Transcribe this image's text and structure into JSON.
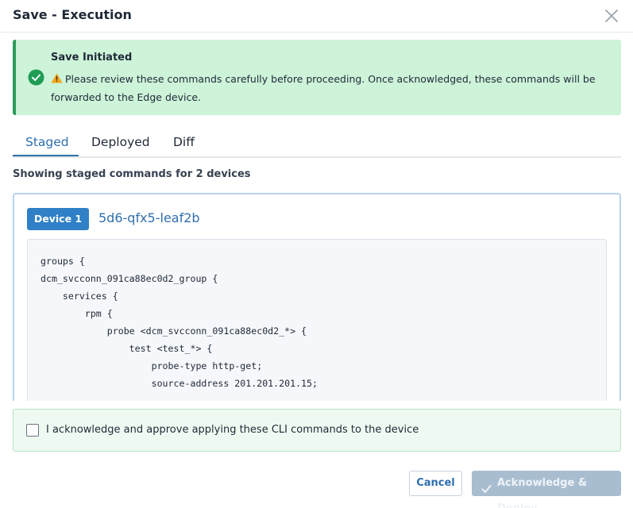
{
  "modal": {
    "title": "Save - Execution",
    "close_icon": "close-icon"
  },
  "alert": {
    "icon": "check-circle-icon",
    "title": "Save Initiated",
    "warning_icon": "warning-triangle-icon",
    "message": "Please review these commands carefully before proceeding. Once acknowledged, these commands will be forwarded to the Edge device.",
    "accent_color": "#2e9c5a",
    "background_color": "#cdf3d9"
  },
  "tabs": [
    {
      "label": "Staged",
      "active": true
    },
    {
      "label": "Deployed",
      "active": false
    },
    {
      "label": "Diff",
      "active": false
    }
  ],
  "subtitle": "Showing staged commands for 2 devices",
  "device": {
    "badge": "Device 1",
    "name": "5d6-qfx5-leaf2b",
    "code_lines": [
      "groups {",
      "dcm_svcconn_091ca88ec0d2_group {",
      "    services {",
      "        rpm {",
      "            probe <dcm_svcconn_091ca88ec0d2_*> {",
      "                test <test_*> {",
      "                    probe-type http-get;",
      "                    source-address 201.201.201.15;"
    ]
  },
  "acknowledge": {
    "label": "I acknowledge and approve applying these CLI commands to the device",
    "checked": false
  },
  "buttons": {
    "cancel": "Cancel",
    "deploy": "Acknowledge & Deploy",
    "deploy_icon": "check-icon"
  },
  "colors": {
    "primary": "#2f6fad",
    "badge": "#2f80c6",
    "disabled_button": "#a9bdd0"
  }
}
